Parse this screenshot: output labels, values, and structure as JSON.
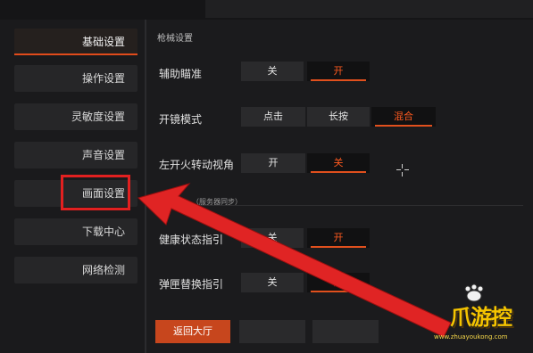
{
  "sidebar": {
    "items": [
      {
        "label": "基础设置",
        "active": true
      },
      {
        "label": "操作设置"
      },
      {
        "label": "灵敏度设置"
      },
      {
        "label": "声音设置"
      },
      {
        "label": "画面设置"
      },
      {
        "label": "下载中心"
      },
      {
        "label": "网络检测"
      }
    ]
  },
  "main": {
    "section_title": "枪械设置",
    "rows": [
      {
        "label": "辅助瞄准",
        "options": [
          "关",
          "开"
        ],
        "selected": "开"
      },
      {
        "label": "开镜模式",
        "options": [
          "点击",
          "长按",
          "混合"
        ],
        "selected": "混合"
      },
      {
        "label": "左开火转动视角",
        "options": [
          "开",
          "关"
        ],
        "selected": "关"
      },
      {
        "label": "健康状态指引",
        "options": [
          "关",
          "开"
        ],
        "selected": "开"
      },
      {
        "label": "弹匣替换指引",
        "options": [
          "关",
          "开"
        ],
        "selected": "开"
      }
    ],
    "note": "（服务器同步）",
    "return_button": "返回大厅"
  },
  "overlay": {
    "highlight_target": "画面设置",
    "arrow_color": "#e02424",
    "watermark_text": "爪游控",
    "watermark_url": "www.zhuayoukong.com"
  },
  "colors": {
    "accent": "#e14b1b",
    "selected_text": "#ff5a1f",
    "highlight": "#e22020",
    "logo": "#f5c400"
  }
}
